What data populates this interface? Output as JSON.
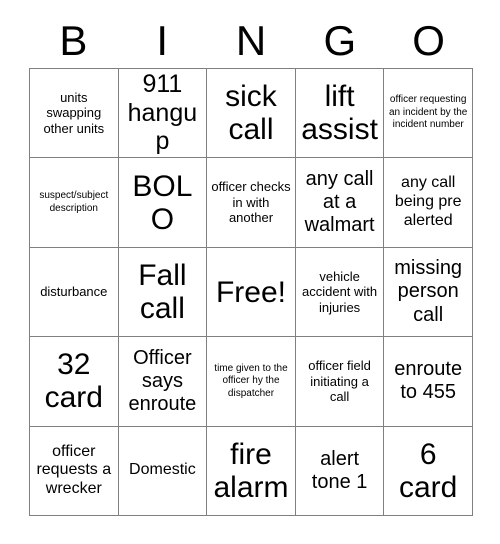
{
  "card": {
    "type": "bingo-card",
    "header_letters": [
      "B",
      "I",
      "N",
      "G",
      "O"
    ],
    "columns": 5,
    "rows": 5,
    "border_color": "#808080",
    "background_color": "#ffffff",
    "text_color": "#000000",
    "free_space": {
      "row": 2,
      "column": 2,
      "label": "Free!"
    },
    "cells": [
      [
        {
          "text": "units swapping other units",
          "size": "fs-s"
        },
        {
          "text": "911 hangup",
          "size": "fs-xl"
        },
        {
          "text": "sick call",
          "size": "fs-xxl"
        },
        {
          "text": "lift assist",
          "size": "fs-xxl"
        },
        {
          "text": "officer requesting an incident by the incident number",
          "size": "fs-xs"
        }
      ],
      [
        {
          "text": "suspect/subject description",
          "size": "fs-xs"
        },
        {
          "text": "BOLO",
          "size": "fs-xxl"
        },
        {
          "text": "officer checks in with another",
          "size": "fs-s"
        },
        {
          "text": "any call at a walmart",
          "size": "fs-l"
        },
        {
          "text": "any call being pre alerted",
          "size": "fs-m"
        }
      ],
      [
        {
          "text": "disturbance",
          "size": "fs-s"
        },
        {
          "text": "Fall call",
          "size": "fs-xxl"
        },
        {
          "text": "Free!",
          "size": "fs-xxl"
        },
        {
          "text": "vehicle accident with injuries",
          "size": "fs-s"
        },
        {
          "text": "missing person call",
          "size": "fs-l"
        }
      ],
      [
        {
          "text": "32 card",
          "size": "fs-xxl"
        },
        {
          "text": "Officer says enroute",
          "size": "fs-l"
        },
        {
          "text": "time given to the officer hy the dispatcher",
          "size": "fs-xs"
        },
        {
          "text": "officer field initiating a call",
          "size": "fs-s"
        },
        {
          "text": "enroute to 455",
          "size": "fs-l"
        }
      ],
      [
        {
          "text": "officer requests a wrecker",
          "size": "fs-m"
        },
        {
          "text": "Domestic",
          "size": "fs-m"
        },
        {
          "text": "fire alarm",
          "size": "fs-xxl"
        },
        {
          "text": "alert tone 1",
          "size": "fs-l"
        },
        {
          "text": "6 card",
          "size": "fs-xxl"
        }
      ]
    ]
  }
}
